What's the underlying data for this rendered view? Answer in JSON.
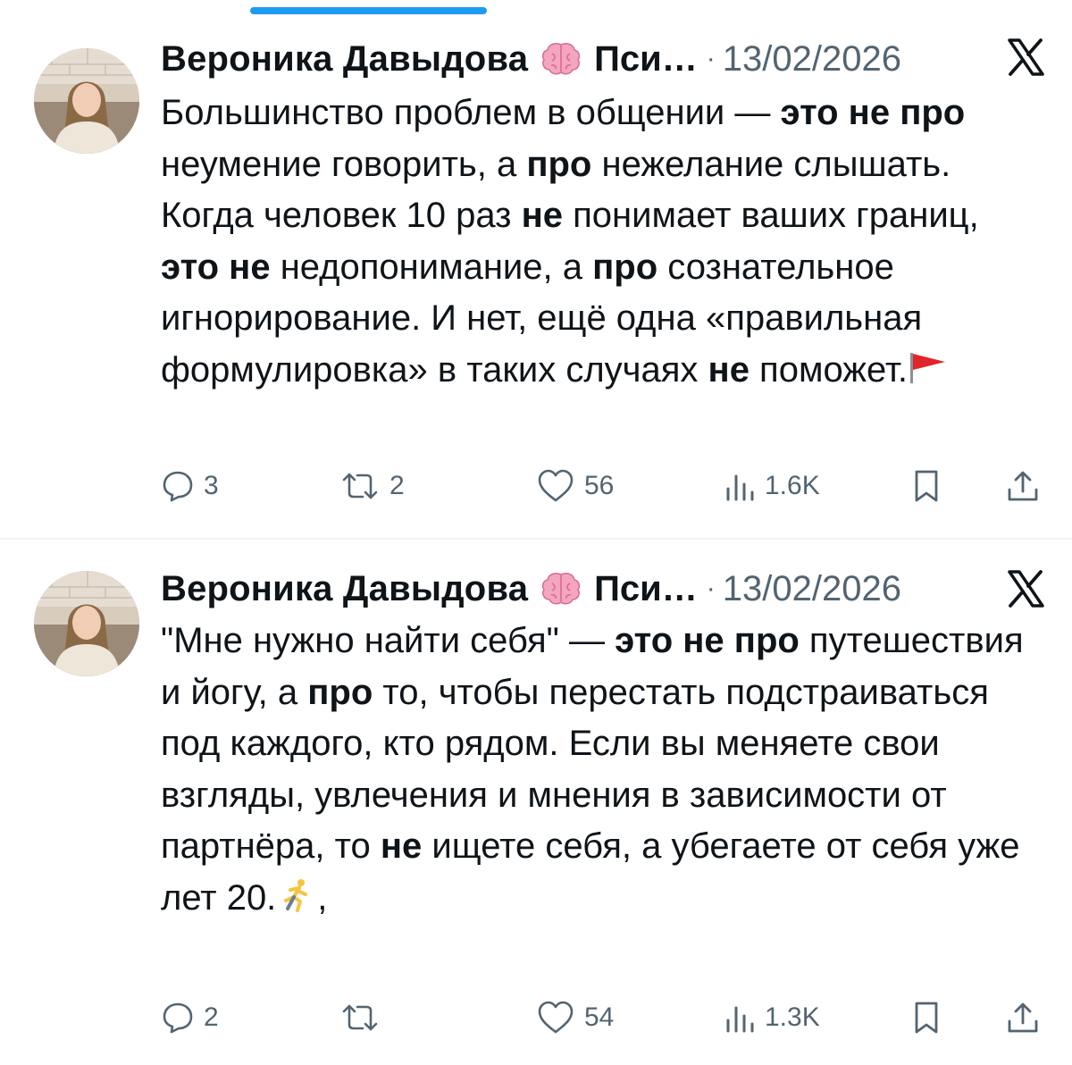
{
  "tweets": [
    {
      "author_name": "Вероника Давыдова",
      "author_suffix": "Пси…",
      "separator": "·",
      "date": "13/02/2026",
      "body_segments": [
        {
          "text": "Большинство проблем в общении — ",
          "bold": false
        },
        {
          "text": "это не про",
          "bold": true
        },
        {
          "text": " неумение говорить, а ",
          "bold": false
        },
        {
          "text": "про",
          "bold": true
        },
        {
          "text": " нежелание слышать. Когда человек 10 раз ",
          "bold": false
        },
        {
          "text": "не",
          "bold": true
        },
        {
          "text": " понимает ваших границ, ",
          "bold": false
        },
        {
          "text": "это не",
          "bold": true
        },
        {
          "text": " недопонимание, а ",
          "bold": false
        },
        {
          "text": "про",
          "bold": true
        },
        {
          "text": " сознательное игнорирование. И нет, ещё одна «правильная формулировка» в таких случаях ",
          "bold": false
        },
        {
          "text": "не",
          "bold": true
        },
        {
          "text": " поможет.",
          "bold": false
        }
      ],
      "trailing_emoji": "red-flag-emoji",
      "replies": "3",
      "retweets": "2",
      "likes": "56",
      "views": "1.6K"
    },
    {
      "author_name": "Вероника Давыдова",
      "author_suffix": "Пси…",
      "separator": "·",
      "date": "13/02/2026",
      "body_segments": [
        {
          "text": "\"Мне нужно найти себя\" — ",
          "bold": false
        },
        {
          "text": "это не про",
          "bold": true
        },
        {
          "text": " путешествия и йогу, а ",
          "bold": false
        },
        {
          "text": "про",
          "bold": true
        },
        {
          "text": " то, чтобы перестать подстраиваться под каждого, кто рядом. Если вы меняете свои взгляды, увлечения и мнения в зависимости от партнёра, то ",
          "bold": false
        },
        {
          "text": "не",
          "bold": true
        },
        {
          "text": " ищете себя, а убегаете от себя уже лет 20.",
          "bold": false
        }
      ],
      "trailing_emoji": "running-person-emoji",
      "trailing_text": ",",
      "replies": "2",
      "retweets": "",
      "likes": "54",
      "views": "1.3K"
    }
  ],
  "colors": {
    "text": "#0f1419",
    "muted": "#536471",
    "accent": "#1d9bf0",
    "divider": "#eff3f4"
  },
  "icons": {
    "header": [
      "brain-icon",
      "x-logo-icon"
    ],
    "actions": [
      "reply-icon",
      "retweet-icon",
      "like-icon",
      "views-icon",
      "bookmark-icon",
      "share-icon"
    ]
  }
}
